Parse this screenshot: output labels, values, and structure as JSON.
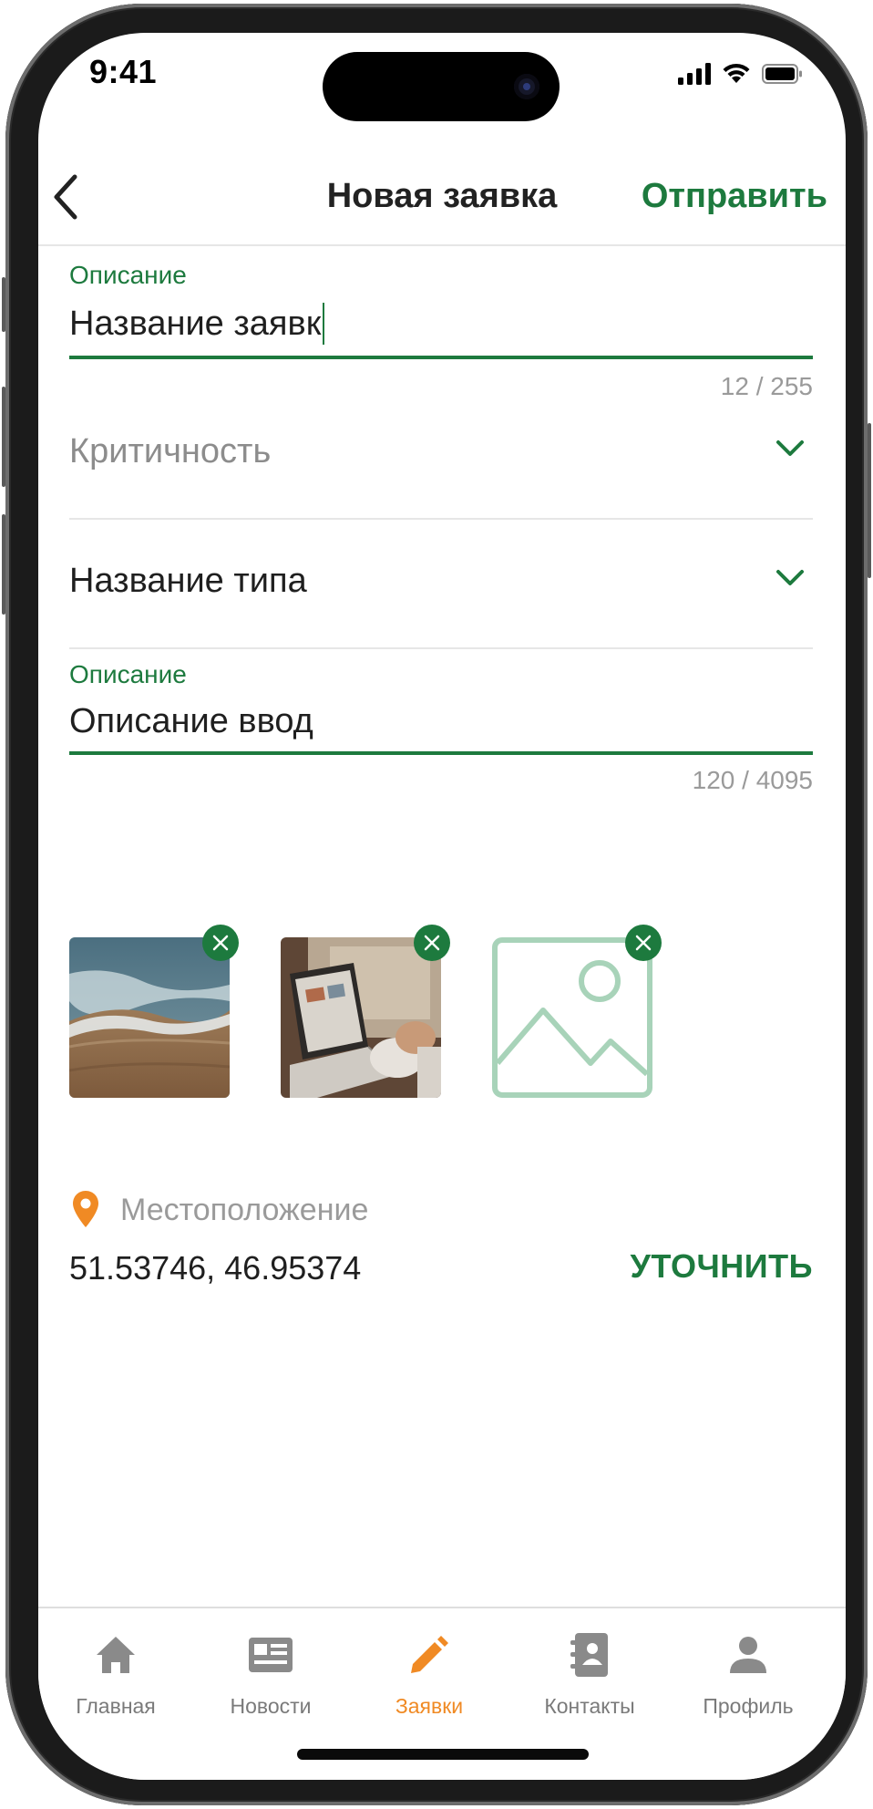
{
  "status_bar": {
    "time": "9:41"
  },
  "header": {
    "title": "Новая заявка",
    "send_label": "Отправить"
  },
  "title_field": {
    "label": "Описание",
    "value": "Название заявк",
    "counter": "12 / 255"
  },
  "criticality_select": {
    "placeholder": "Критичность"
  },
  "type_select": {
    "value": "Название типа"
  },
  "description_field": {
    "label": "Описание",
    "value": "Описание ввод",
    "counter": "120 / 4095"
  },
  "attachments": [
    {
      "kind": "photo",
      "subject": "sea-shore"
    },
    {
      "kind": "photo",
      "subject": "laptop"
    },
    {
      "kind": "placeholder",
      "subject": "image-placeholder-icon"
    }
  ],
  "location": {
    "label": "Местоположение",
    "coords": "51.53746, 46.95374",
    "refine_label": "УТОЧНИТЬ"
  },
  "tabbar": {
    "items": [
      {
        "label": "Главная",
        "icon": "home-icon"
      },
      {
        "label": "Новости",
        "icon": "news-icon"
      },
      {
        "label": "Заявки",
        "icon": "pencil-icon",
        "active": true
      },
      {
        "label": "Контакты",
        "icon": "contacts-icon"
      },
      {
        "label": "Профиль",
        "icon": "profile-icon"
      }
    ]
  },
  "colors": {
    "accent": "#1d7a3e",
    "active_tab": "#f08a24",
    "muted": "#9a9a9a"
  }
}
